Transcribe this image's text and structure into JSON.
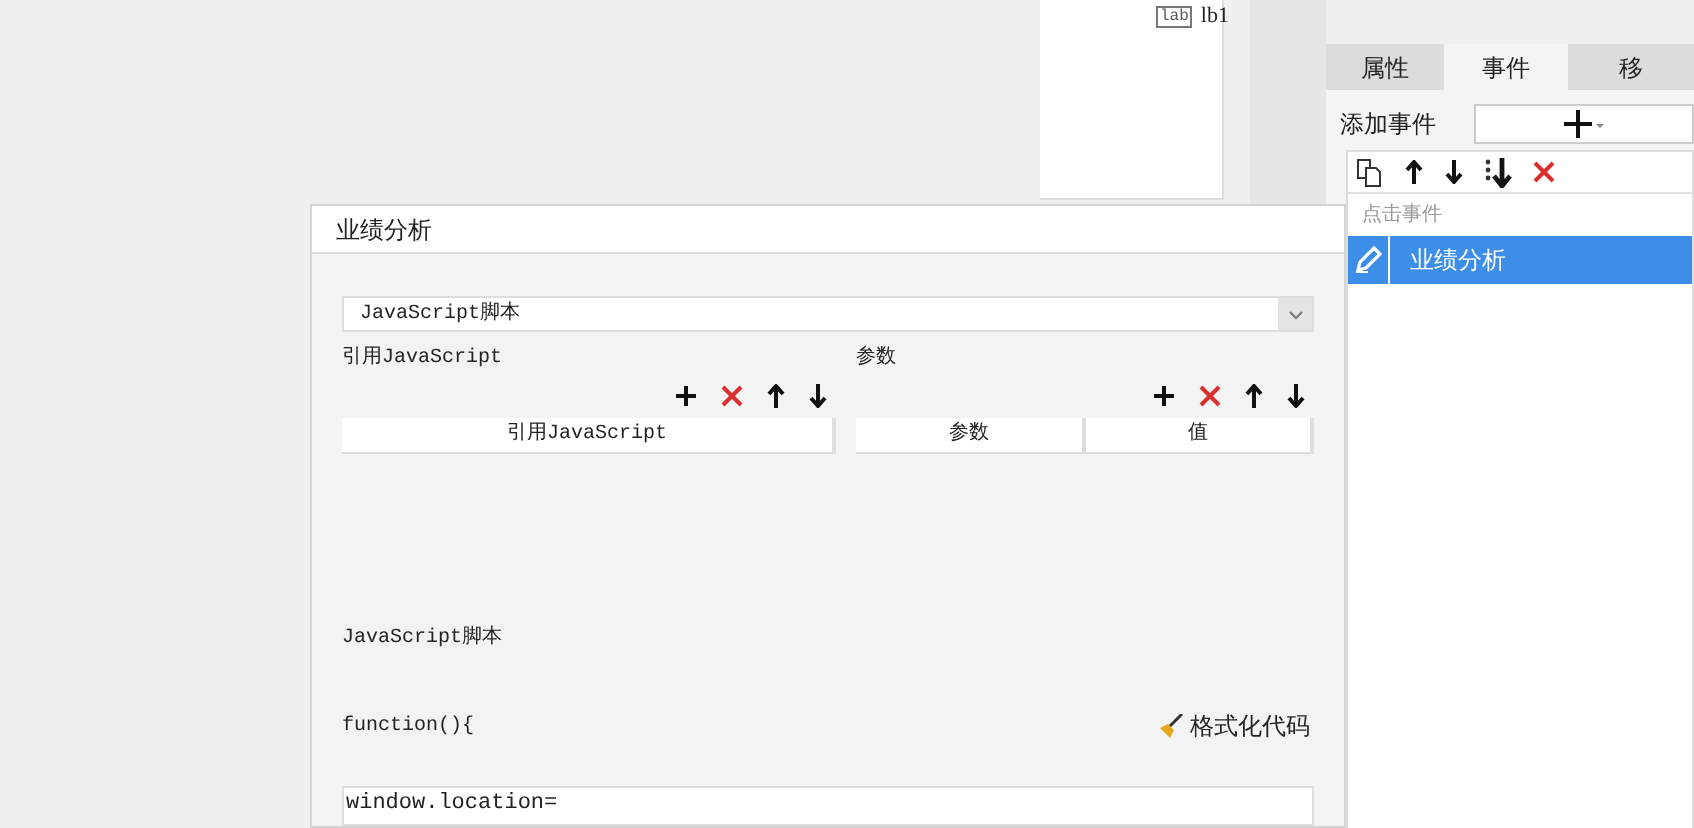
{
  "designer": {
    "component": {
      "badge": "lab",
      "name": "lb1"
    }
  },
  "panel": {
    "tabs": [
      {
        "label": "属性",
        "selected": false
      },
      {
        "label": "事件",
        "selected": true
      },
      {
        "label": "移",
        "selected": false
      }
    ],
    "add_event_label": "添加事件",
    "event_group": "点击事件",
    "events": [
      {
        "label": "业绩分析",
        "selected": true
      }
    ]
  },
  "dialog": {
    "title": "业绩分析",
    "type_select": {
      "value": "JavaScript脚本"
    },
    "references": {
      "label": "引用JavaScript",
      "columns": [
        "引用JavaScript"
      ]
    },
    "parameters": {
      "label": "参数",
      "columns": [
        "参数",
        "值"
      ]
    },
    "script_label": "JavaScript脚本",
    "function_header": "function(){",
    "format_button": "格式化代码",
    "code": "window.location="
  }
}
